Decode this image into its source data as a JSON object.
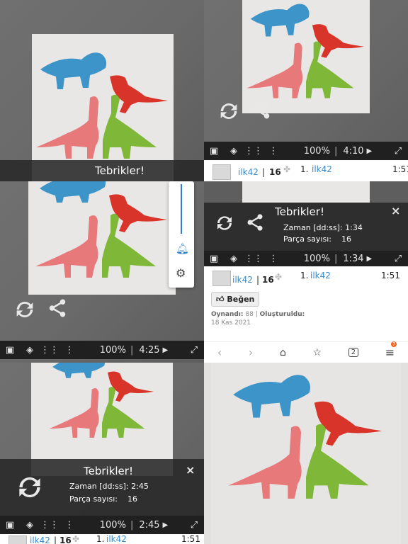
{
  "overlay": {
    "title": "Tebrikler!",
    "time_label": "Zaman [dd:ss]:",
    "pieces_label": "Parça sayısı:",
    "close": "×"
  },
  "toolbar": {
    "zoom": "100%",
    "sep": "|",
    "play": "▶"
  },
  "times": {
    "t1": "4:10",
    "t2": "4:25",
    "t3": "1:34",
    "t4": "2:45"
  },
  "results": {
    "time_a": "1:34",
    "time_b": "2:45",
    "pieces": "16"
  },
  "user": {
    "name": "ilk42",
    "pieces": "16",
    "rank": "1.",
    "rank_time": "1:51"
  },
  "like": {
    "label": "Beğen",
    "icon": "thumbs-up-icon"
  },
  "meta": {
    "played_label": "Oynandı:",
    "played_value": "88",
    "created_label": "Oluşturuldu:",
    "created_value": "18 Kas 2021"
  },
  "browser": {
    "tab_count": "2",
    "badge": "7"
  }
}
